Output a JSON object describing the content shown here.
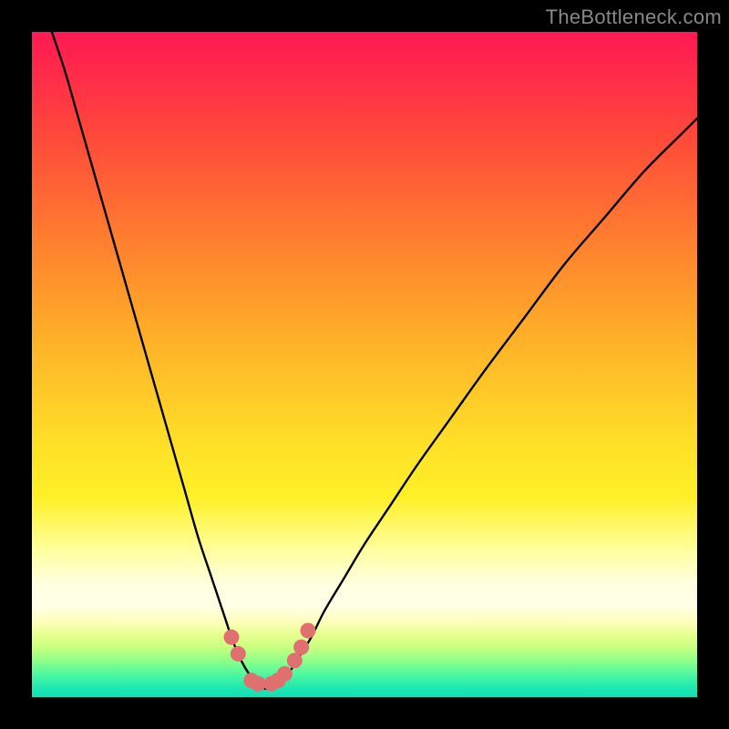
{
  "watermark": {
    "text": "TheBottleneck.com"
  },
  "colors": {
    "bg_black": "#000000",
    "curve": "#000000",
    "marker_fill": "#e07070",
    "watermark": "#888888",
    "gradient_stops": [
      {
        "offset": 0.0,
        "color": "#ff1a54"
      },
      {
        "offset": 0.06,
        "color": "#ff2a4a"
      },
      {
        "offset": 0.16,
        "color": "#ff4a3a"
      },
      {
        "offset": 0.3,
        "color": "#ff7a30"
      },
      {
        "offset": 0.46,
        "color": "#ffb028"
      },
      {
        "offset": 0.62,
        "color": "#ffe028"
      },
      {
        "offset": 0.7,
        "color": "#fff028"
      },
      {
        "offset": 0.78,
        "color": "#ffffa0"
      },
      {
        "offset": 0.83,
        "color": "#ffffe0"
      },
      {
        "offset": 0.86,
        "color": "#ffffe8"
      },
      {
        "offset": 0.885,
        "color": "#ffffc0"
      },
      {
        "offset": 0.905,
        "color": "#e8ff90"
      },
      {
        "offset": 0.925,
        "color": "#c8ff80"
      },
      {
        "offset": 0.945,
        "color": "#90ff88"
      },
      {
        "offset": 0.965,
        "color": "#50f8a0"
      },
      {
        "offset": 0.985,
        "color": "#20e8b0"
      },
      {
        "offset": 1.0,
        "color": "#10e0b8"
      }
    ]
  },
  "chart_data": {
    "type": "line",
    "title": "",
    "xlabel": "",
    "ylabel": "",
    "xlim": [
      0,
      100
    ],
    "ylim": [
      0,
      100
    ],
    "grid": false,
    "note": "Bottleneck-style curve: y is bottleneck % (0 good, 100 bad). Minimum around x≈35. Left branch steeper than right.",
    "x": [
      3,
      5,
      7,
      9,
      11,
      13,
      15,
      17,
      19,
      21,
      23,
      25,
      27,
      29,
      30,
      31,
      32,
      33,
      34,
      35,
      36,
      37,
      38,
      39,
      40,
      42,
      44,
      47,
      50,
      54,
      58,
      63,
      68,
      74,
      80,
      86,
      92,
      98,
      100
    ],
    "series": [
      {
        "name": "bottleneck-curve",
        "values": [
          100,
          94,
          87,
          80,
          73,
          66,
          59,
          52,
          45,
          38,
          31,
          24,
          18,
          12,
          9,
          6.5,
          4.5,
          3,
          2,
          1.3,
          1.3,
          2,
          3,
          4.2,
          5.8,
          9,
          13,
          18,
          23,
          29,
          35,
          42,
          49,
          57,
          65,
          72,
          79,
          85,
          87
        ]
      }
    ],
    "markers": {
      "name": "highlight-points",
      "points": [
        {
          "x": 30,
          "y": 9
        },
        {
          "x": 31,
          "y": 6.5
        },
        {
          "x": 33,
          "y": 2.5
        },
        {
          "x": 34,
          "y": 2
        },
        {
          "x": 36,
          "y": 2
        },
        {
          "x": 37,
          "y": 2.5
        },
        {
          "x": 38,
          "y": 3.5
        },
        {
          "x": 39.5,
          "y": 5.5
        },
        {
          "x": 40.5,
          "y": 7.5
        },
        {
          "x": 41.5,
          "y": 10
        }
      ]
    }
  }
}
